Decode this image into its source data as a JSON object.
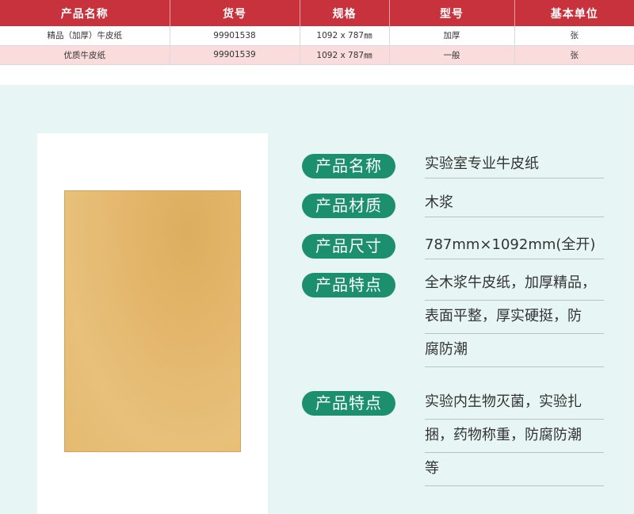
{
  "table": {
    "headers": [
      "产品名称",
      "货号",
      "规格",
      "型号",
      "基本单位"
    ],
    "rows": [
      [
        "精品（加厚）牛皮纸",
        "99901538",
        "1092 x 787㎜",
        "加厚",
        "张"
      ],
      [
        "优质牛皮纸",
        "99901539",
        "1092 x 787㎜",
        "一般",
        "张"
      ]
    ]
  },
  "features": [
    {
      "label": "产品名称",
      "lines": [
        "实验室专业牛皮纸"
      ]
    },
    {
      "label": "产品材质",
      "lines": [
        "木浆"
      ]
    },
    {
      "label": "产品尺寸",
      "lines": [
        "787mm×1092mm(全开)"
      ]
    },
    {
      "label": "产品特点",
      "lines": [
        "全木浆牛皮纸，加厚精品，",
        "表面平整，厚实硬挺，防",
        "腐防潮"
      ]
    },
    {
      "label": "产品特点",
      "lines": [
        "实验内生物灭菌，实验扎",
        "捆，药物称重，防腐防潮",
        "等"
      ]
    }
  ],
  "colors": {
    "header_red": "#c8323c",
    "row_pink": "#fbdcdc",
    "badge_green": "#1c8f6f",
    "panel_bg": "#e7f6f4",
    "kraft": "#e6bb71"
  }
}
